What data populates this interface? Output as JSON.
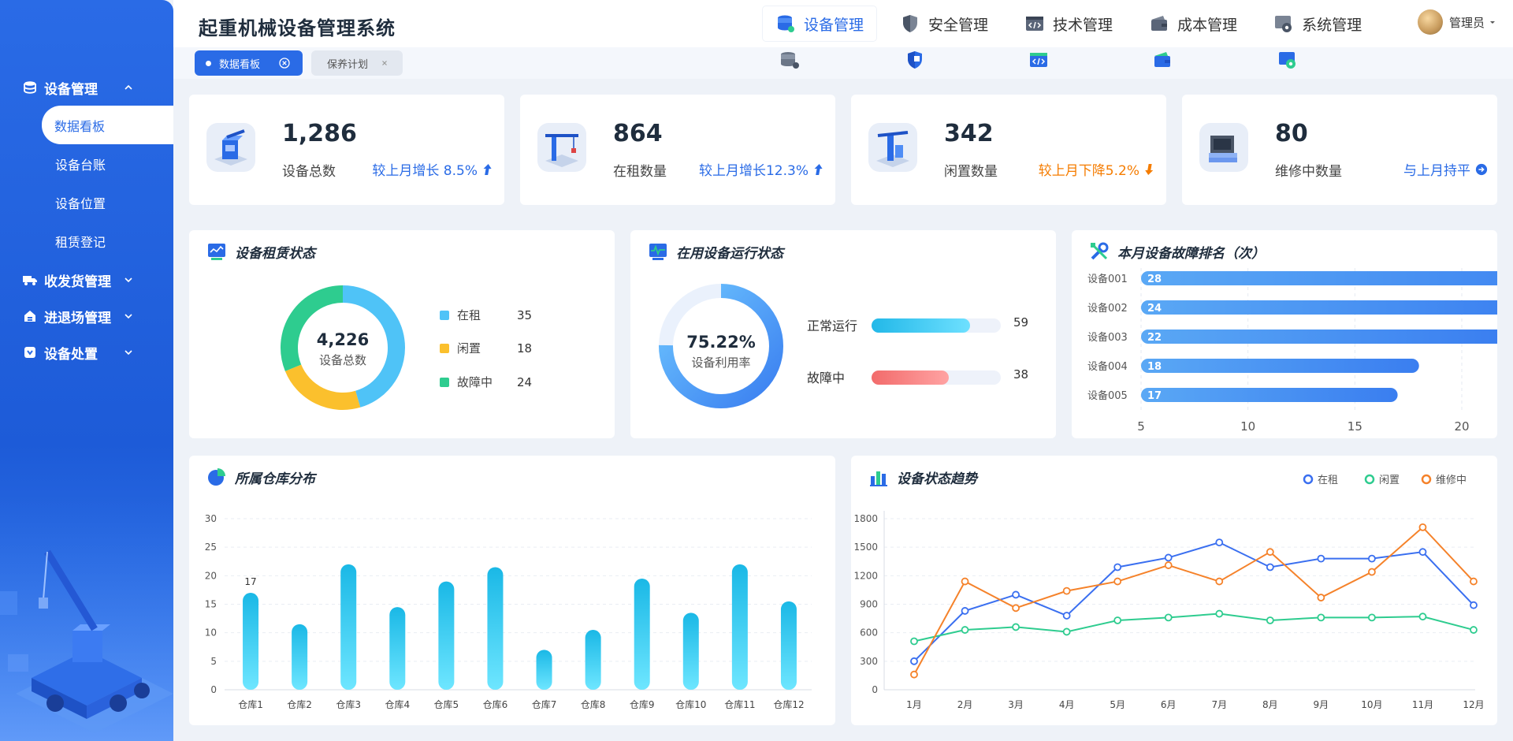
{
  "app": {
    "title": "起重机械设备管理系统"
  },
  "nav": [
    {
      "label": "设备管理",
      "icon": "database-icon",
      "active": true
    },
    {
      "label": "安全管理",
      "icon": "shield-icon",
      "active": false
    },
    {
      "label": "技术管理",
      "icon": "code-icon",
      "active": false
    },
    {
      "label": "成本管理",
      "icon": "wallet-icon",
      "active": false
    },
    {
      "label": "系统管理",
      "icon": "settings-icon",
      "active": false
    }
  ],
  "user": {
    "name": "管理员"
  },
  "tabs": [
    {
      "label": "数据看板",
      "active": true
    },
    {
      "label": "保养计划",
      "active": false
    }
  ],
  "sidebar": {
    "groups": [
      {
        "label": "设备管理",
        "icon": "database-icon",
        "expanded": true,
        "items": [
          "数据看板",
          "设备台账",
          "设备位置",
          "租赁登记"
        ]
      },
      {
        "label": "收发货管理",
        "icon": "truck-icon",
        "expanded": false
      },
      {
        "label": "进退场管理",
        "icon": "site-icon",
        "expanded": false
      },
      {
        "label": "设备处置",
        "icon": "disposal-icon",
        "expanded": false
      }
    ]
  },
  "stats": [
    {
      "value": "1,286",
      "label": "设备总数",
      "trend": "较上月增长 8.5%",
      "trend_dir": "up",
      "icon": "crane-machine-icon"
    },
    {
      "value": "864",
      "label": "在租数量",
      "trend": "较上月增长12.3%",
      "trend_dir": "up",
      "icon": "tower-crane-icon"
    },
    {
      "value": "342",
      "label": "闲置数量",
      "trend": "较上月下降5.2%",
      "trend_dir": "down",
      "icon": "idle-crane-icon"
    },
    {
      "value": "80",
      "label": "维修中数量",
      "trend": "与上月持平",
      "trend_dir": "flat",
      "icon": "repair-device-icon"
    }
  ],
  "rental": {
    "title": "设备租赁状态",
    "center_value": "4,226",
    "center_label": "设备总数",
    "legend": [
      {
        "label": "在租",
        "value": "35",
        "color": "#4fc3f7"
      },
      {
        "label": "闲置",
        "value": "18",
        "color": "#fbc02d"
      },
      {
        "label": "故障中",
        "value": "24",
        "color": "#2ecc8f"
      }
    ]
  },
  "running": {
    "title": "在用设备运行状态",
    "gauge_value": "75.22%",
    "gauge_label": "设备利用率",
    "gauge_fraction": 0.7522,
    "rows": [
      {
        "label": "正常运行",
        "value": "59",
        "fraction": 0.76
      },
      {
        "label": "故障中",
        "value": "38",
        "fraction": 0.6
      }
    ]
  },
  "fault_rank": {
    "title": "本月设备故障排名（次）",
    "chart_data": {
      "type": "bar",
      "orientation": "horizontal",
      "categories": [
        "设备001",
        "设备002",
        "设备003",
        "设备004",
        "设备005"
      ],
      "values": [
        28,
        24,
        22,
        18,
        17
      ],
      "xlim": [
        5,
        20
      ],
      "xticks": [
        "5",
        "10",
        "15",
        "20"
      ]
    }
  },
  "warehouse": {
    "title": "所属仓库分布",
    "chart_data": {
      "type": "bar",
      "categories": [
        "仓库1",
        "仓库2",
        "仓库3",
        "仓库4",
        "仓库5",
        "仓库6",
        "仓库7",
        "仓库8",
        "仓库9",
        "仓库10",
        "仓库11",
        "仓库12"
      ],
      "values": [
        17,
        11.5,
        22,
        14.5,
        19,
        21.5,
        7,
        10.5,
        19.5,
        13.5,
        22,
        15.5
      ],
      "ylim": [
        0,
        30
      ],
      "yticks": [
        "0",
        "5",
        "10",
        "15",
        "20",
        "25",
        "30"
      ],
      "annotation": {
        "index": 0,
        "text": "17"
      },
      "grid": true
    }
  },
  "trend": {
    "title": "设备状态趋势",
    "chart_data": {
      "type": "line",
      "x": [
        "1月",
        "2月",
        "3月",
        "4月",
        "5月",
        "6月",
        "7月",
        "8月",
        "9月",
        "10月",
        "11月",
        "12月"
      ],
      "ylim": [
        0,
        1800
      ],
      "yticks": [
        "0",
        "300",
        "600",
        "900",
        "1200",
        "1500",
        "1800"
      ],
      "legend_position": "top-right",
      "series": [
        {
          "name": "在租",
          "color": "#3a6ff0",
          "values": [
            300,
            830,
            1000,
            780,
            1290,
            1390,
            1550,
            1290,
            1380,
            1380,
            1450,
            890
          ]
        },
        {
          "name": "闲置",
          "color": "#2ecc8f",
          "values": [
            510,
            630,
            660,
            610,
            730,
            760,
            800,
            730,
            760,
            760,
            770,
            630
          ]
        },
        {
          "name": "维修中",
          "color": "#f5822a",
          "values": [
            160,
            1140,
            860,
            1040,
            1140,
            1310,
            1140,
            1450,
            970,
            1240,
            1710,
            1140
          ]
        }
      ]
    }
  }
}
